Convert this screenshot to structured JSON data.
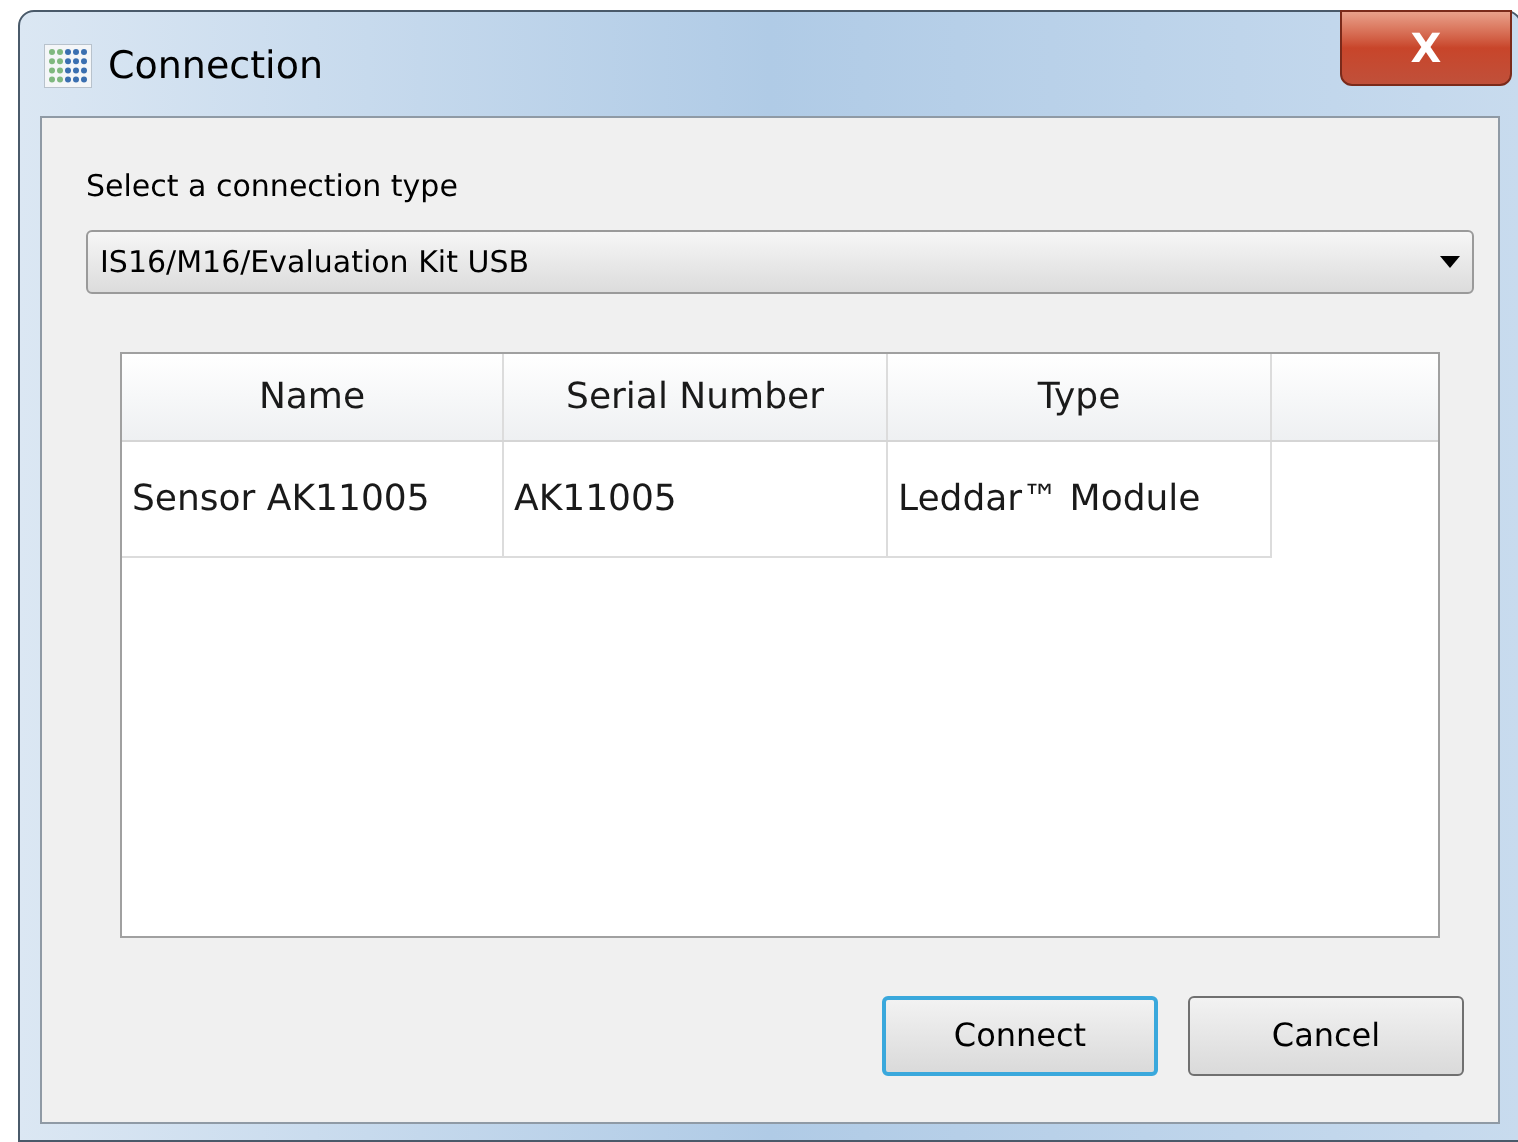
{
  "window": {
    "title": "Connection",
    "close_label": "X"
  },
  "connection_type": {
    "label": "Select a connection type",
    "value": "IS16/M16/Evaluation Kit USB"
  },
  "table": {
    "columns": [
      "Name",
      "Serial Number",
      "Type"
    ],
    "rows": [
      {
        "cells": [
          "Sensor AK11005",
          "AK11005",
          "Leddar™ Module"
        ]
      }
    ]
  },
  "buttons": [
    {
      "label": "Connect",
      "default": true
    },
    {
      "label": "Cancel",
      "default": false
    }
  ]
}
